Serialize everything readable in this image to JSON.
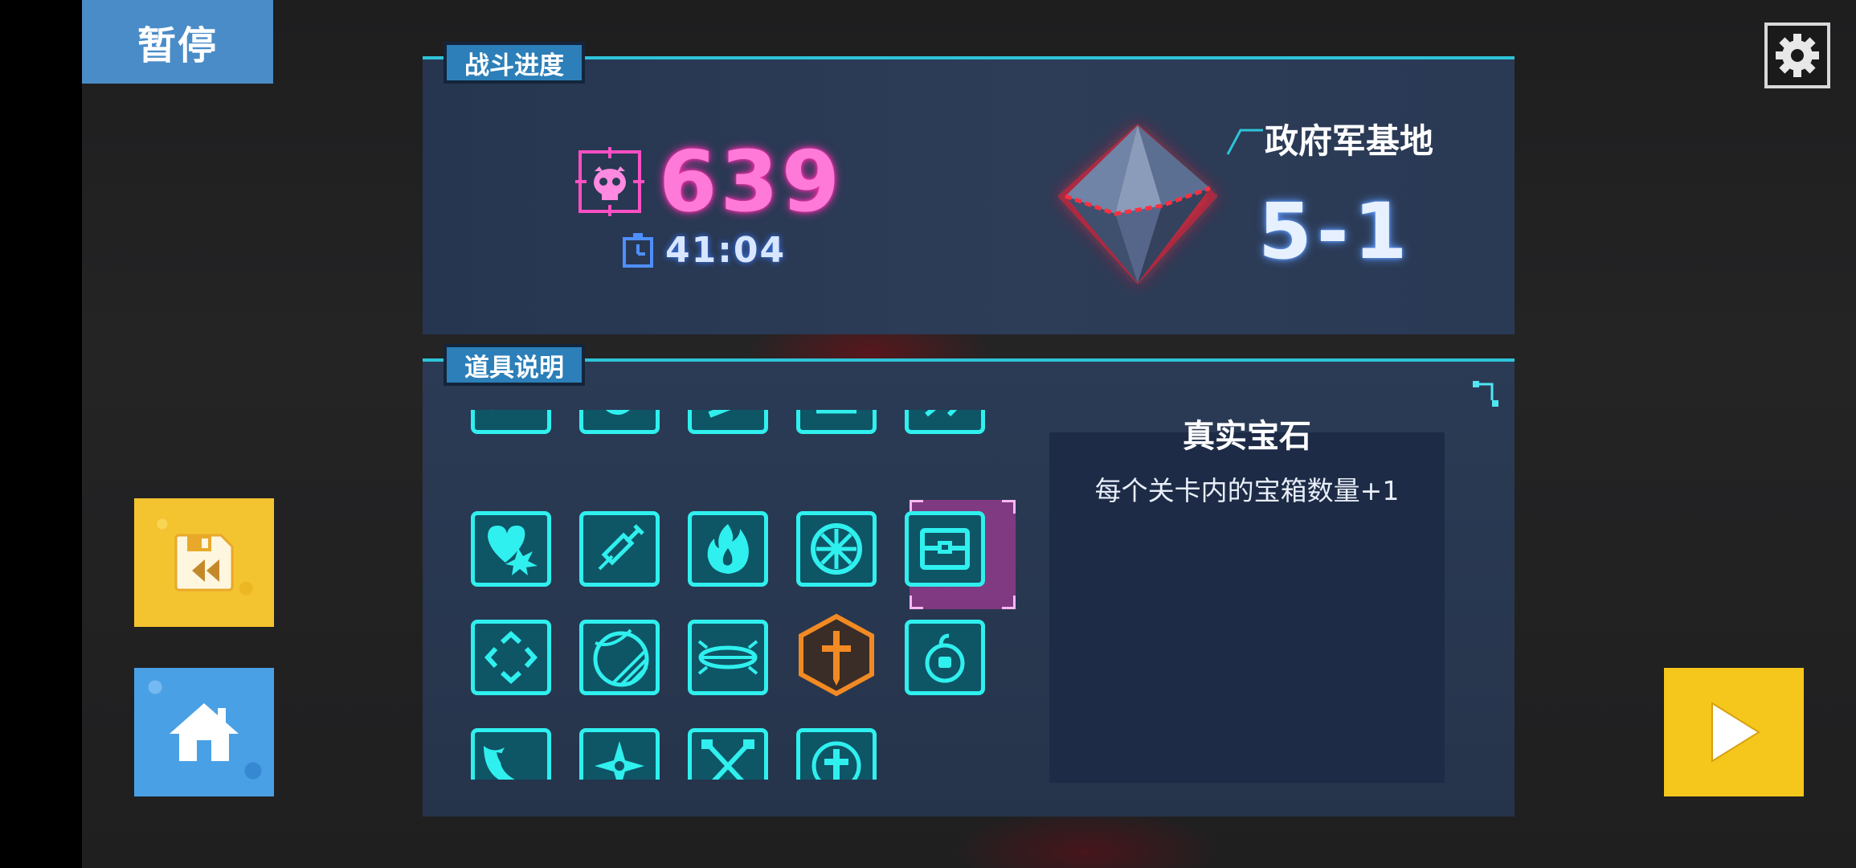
{
  "header": {
    "pause_title": "暂停"
  },
  "icons": {
    "settings": "gear-icon",
    "save": "floppy-rewind-icon",
    "home": "home-icon",
    "play": "play-icon"
  },
  "progress": {
    "tab_label": "战斗进度",
    "kill_count": "639",
    "time": "41:04",
    "location": "政府军基地",
    "stage": "5-1"
  },
  "items": {
    "tab_label": "道具说明",
    "slots": [
      {
        "icon": "partial-item-1-icon"
      },
      {
        "icon": "partial-item-2-icon"
      },
      {
        "icon": "partial-item-3-icon"
      },
      {
        "icon": "partial-item-4-icon"
      },
      {
        "icon": "partial-item-5-icon"
      },
      {
        "icon": "heart-burst-icon"
      },
      {
        "icon": "syringe-icon"
      },
      {
        "icon": "flame-icon"
      },
      {
        "icon": "wheel-icon"
      },
      {
        "icon": "treasure-chest-icon",
        "selected": true
      },
      {
        "icon": "diamond-arrows-icon"
      },
      {
        "icon": "striped-ball-icon"
      },
      {
        "icon": "platform-icon"
      },
      {
        "icon": "sword-hexagon-icon",
        "color": "orange"
      },
      {
        "icon": "grenade-icon"
      },
      {
        "icon": "wave-icon"
      },
      {
        "icon": "shuriken-icon"
      },
      {
        "icon": "dna-icon"
      },
      {
        "icon": "cross-shield-icon"
      }
    ],
    "selected": {
      "name": "真实宝石",
      "description": "每个关卡内的宝箱数量+1"
    }
  },
  "colors": {
    "accent_cyan": "#2ff0ee",
    "kill_pink": "#ff7ad8",
    "tab_blue": "#2c7fb8",
    "save_yellow": "#f3c430",
    "home_blue": "#4aa0e4",
    "play_yellow": "#f5c61c"
  }
}
